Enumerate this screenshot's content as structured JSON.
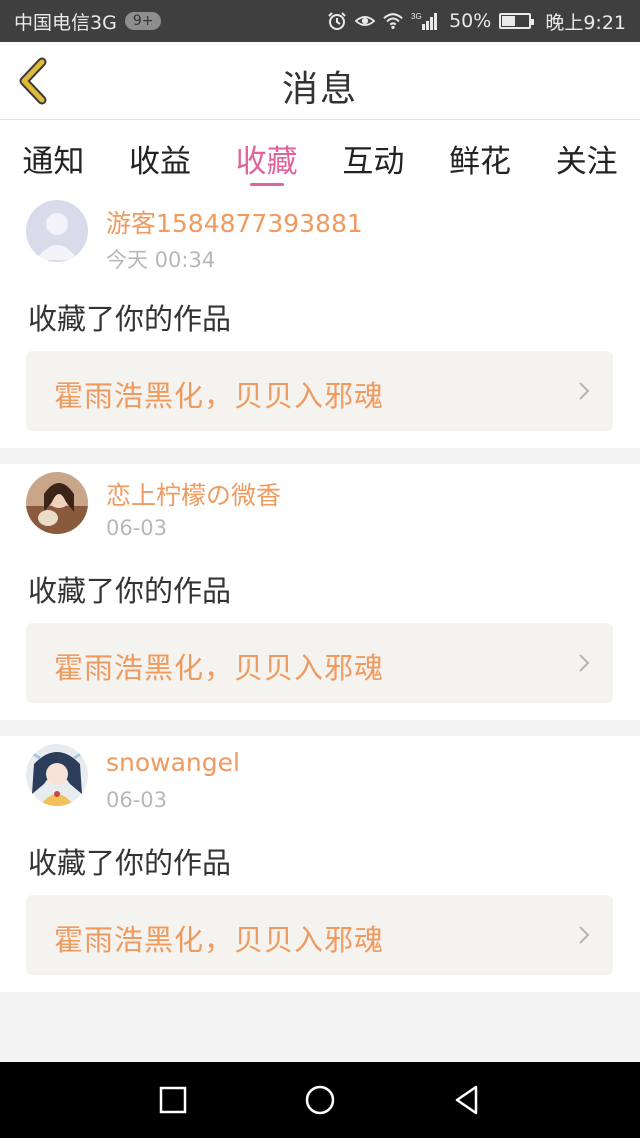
{
  "status_bar": {
    "carrier": "中国电信3G",
    "badge": "9+",
    "signal_type": "3G",
    "battery": "50%",
    "battery_level": 0.5,
    "time": "晚上9:21"
  },
  "header": {
    "title": "消息"
  },
  "tabs": [
    {
      "label": "通知",
      "active": false
    },
    {
      "label": "收益",
      "active": false
    },
    {
      "label": "收藏",
      "active": true
    },
    {
      "label": "互动",
      "active": false
    },
    {
      "label": "鲜花",
      "active": false
    },
    {
      "label": "关注",
      "active": false
    }
  ],
  "messages": [
    {
      "username": "游客1584877393881",
      "time": "今天 00:34",
      "action": "收藏了你的作品",
      "work_title": "霍雨浩黑化，贝贝入邪魂",
      "avatar": "default-avatar"
    },
    {
      "username": "恋上柠檬の微香",
      "time": "06-03",
      "action": "收藏了你的作品",
      "work_title": "霍雨浩黑化，贝贝入邪魂",
      "avatar": "photo-avatar"
    },
    {
      "username": "snowangel",
      "time": "06-03",
      "action": "收藏了你的作品",
      "work_title": "霍雨浩黑化，贝贝入邪魂",
      "avatar": "anime-avatar"
    }
  ],
  "colors": {
    "accent": "#e0639c",
    "username": "#ef9a5e",
    "back_arrow": "#e0b93a"
  }
}
